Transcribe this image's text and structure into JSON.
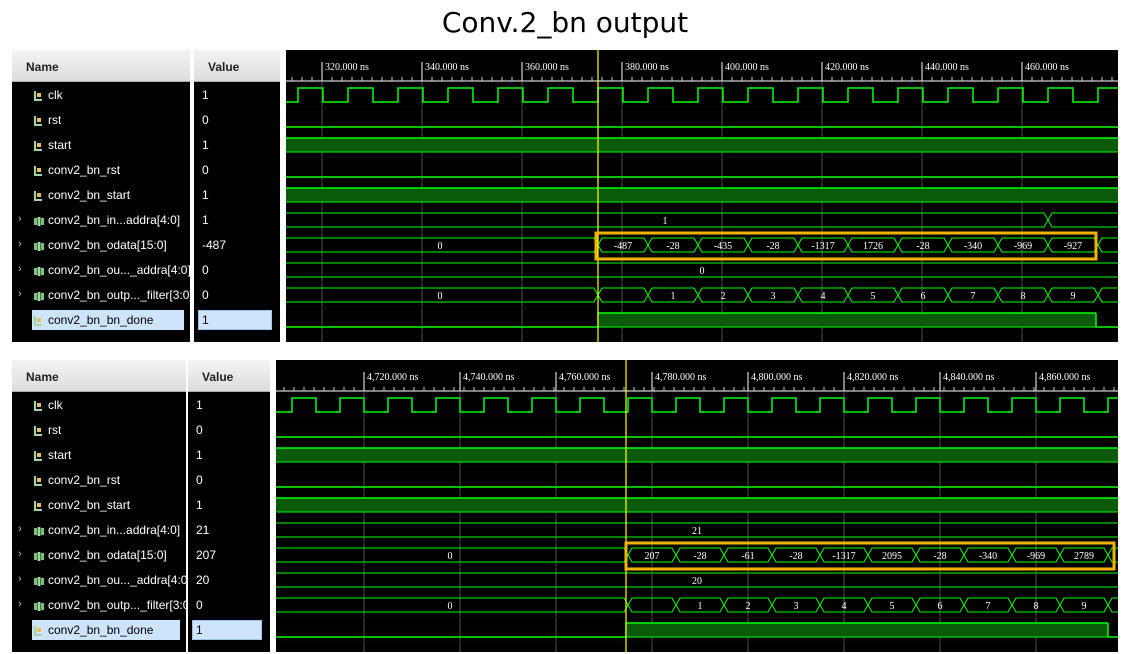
{
  "title": "Conv.2_bn output",
  "columns": {
    "name": "Name",
    "value": "Value"
  },
  "colors": {
    "signal": "#00ff00",
    "bus_fill": "#0a5a0a",
    "cursor": "#ffff00",
    "highlight": "#f0b400"
  },
  "panels": [
    {
      "time_ticks": [
        "320.000 ns",
        "340.000 ns",
        "360.000 ns",
        "380.000 ns",
        "400.000 ns",
        "420.000 ns",
        "440.000 ns",
        "460.000 ns"
      ],
      "signals": [
        {
          "name": "clk",
          "value": "1",
          "icon": "bit-signal-icon",
          "bus": false
        },
        {
          "name": "rst",
          "value": "0",
          "icon": "bit-signal-icon",
          "bus": false
        },
        {
          "name": "start",
          "value": "1",
          "icon": "bit-signal-icon",
          "bus": false
        },
        {
          "name": "conv2_bn_rst",
          "value": "0",
          "icon": "bit-signal-icon",
          "bus": false
        },
        {
          "name": "conv2_bn_start",
          "value": "1",
          "icon": "bit-signal-icon",
          "bus": false
        },
        {
          "name": "conv2_bn_in...addra[4:0]",
          "value": "1",
          "icon": "bus-signal-icon",
          "bus": true
        },
        {
          "name": "conv2_bn_odata[15:0]",
          "value": "-487",
          "icon": "bus-signal-icon",
          "bus": true
        },
        {
          "name": "conv2_bn_ou..._addra[4:0]",
          "value": "0",
          "icon": "bus-signal-icon",
          "bus": true
        },
        {
          "name": "conv2_bn_outp..._filter[3:0]",
          "value": "0",
          "icon": "bus-signal-icon",
          "bus": true
        },
        {
          "name": "conv2_bn_bn_done",
          "value": "1",
          "icon": "bit-signal-icon",
          "bus": false,
          "selected": true
        }
      ],
      "bus_segments": {
        "addra": [
          {
            "label": "1"
          },
          {
            "label": ""
          }
        ],
        "odata": [
          {
            "label": "0"
          },
          {
            "label": "-487"
          },
          {
            "label": "-28"
          },
          {
            "label": "-435"
          },
          {
            "label": "-28"
          },
          {
            "label": "-1317"
          },
          {
            "label": "1726"
          },
          {
            "label": "-28"
          },
          {
            "label": "-340"
          },
          {
            "label": "-969"
          },
          {
            "label": "-927"
          }
        ],
        "out_addra": [
          {
            "label": "0"
          }
        ],
        "filter": [
          {
            "label": "0"
          },
          {
            "label": ""
          },
          {
            "label": "1"
          },
          {
            "label": "2"
          },
          {
            "label": "3"
          },
          {
            "label": "4"
          },
          {
            "label": "5"
          },
          {
            "label": "6"
          },
          {
            "label": "7"
          },
          {
            "label": "8"
          },
          {
            "label": "9"
          }
        ]
      }
    },
    {
      "time_ticks": [
        "4,720.000 ns",
        "4,740.000 ns",
        "4,760.000 ns",
        "4,780.000 ns",
        "4,800.000 ns",
        "4,820.000 ns",
        "4,840.000 ns",
        "4,860.000 ns"
      ],
      "signals": [
        {
          "name": "clk",
          "value": "1",
          "icon": "bit-signal-icon",
          "bus": false
        },
        {
          "name": "rst",
          "value": "0",
          "icon": "bit-signal-icon",
          "bus": false
        },
        {
          "name": "start",
          "value": "1",
          "icon": "bit-signal-icon",
          "bus": false
        },
        {
          "name": "conv2_bn_rst",
          "value": "0",
          "icon": "bit-signal-icon",
          "bus": false
        },
        {
          "name": "conv2_bn_start",
          "value": "1",
          "icon": "bit-signal-icon",
          "bus": false
        },
        {
          "name": "conv2_bn_in...addra[4:0]",
          "value": "21",
          "icon": "bus-signal-icon",
          "bus": true
        },
        {
          "name": "conv2_bn_odata[15:0]",
          "value": "207",
          "icon": "bus-signal-icon",
          "bus": true
        },
        {
          "name": "conv2_bn_ou..._addra[4:0]",
          "value": "20",
          "icon": "bus-signal-icon",
          "bus": true
        },
        {
          "name": "conv2_bn_outp..._filter[3:0]",
          "value": "0",
          "icon": "bus-signal-icon",
          "bus": true
        },
        {
          "name": "conv2_bn_bn_done",
          "value": "1",
          "icon": "bit-signal-icon",
          "bus": false,
          "selected": true
        }
      ],
      "bus_segments": {
        "addra": [
          {
            "label": "21"
          }
        ],
        "odata": [
          {
            "label": "0"
          },
          {
            "label": "207"
          },
          {
            "label": "-28"
          },
          {
            "label": "-61"
          },
          {
            "label": "-28"
          },
          {
            "label": "-1317"
          },
          {
            "label": "2095"
          },
          {
            "label": "-28"
          },
          {
            "label": "-340"
          },
          {
            "label": "-969"
          },
          {
            "label": "2789"
          }
        ],
        "out_addra": [
          {
            "label": "20"
          }
        ],
        "filter": [
          {
            "label": "0"
          },
          {
            "label": ""
          },
          {
            "label": "1"
          },
          {
            "label": "2"
          },
          {
            "label": "3"
          },
          {
            "label": "4"
          },
          {
            "label": "5"
          },
          {
            "label": "6"
          },
          {
            "label": "7"
          },
          {
            "label": "8"
          },
          {
            "label": "9"
          }
        ]
      }
    }
  ]
}
